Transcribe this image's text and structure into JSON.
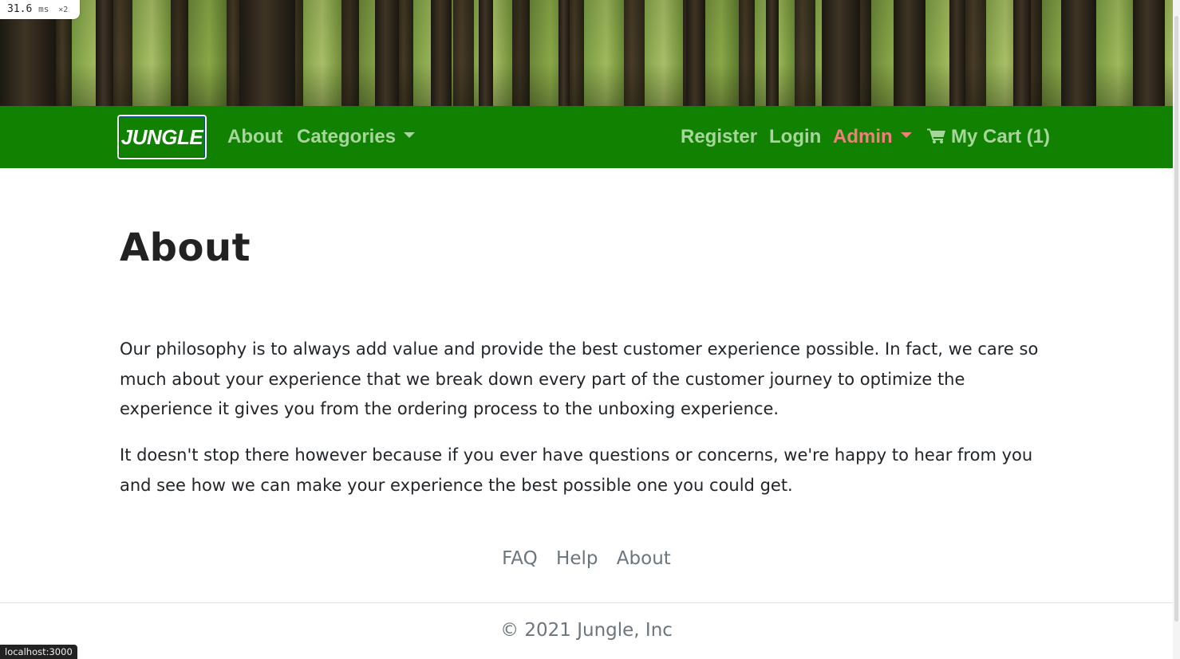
{
  "perf_overlay": {
    "value": "31.6",
    "unit": "ms",
    "multiplier": "×2"
  },
  "navbar": {
    "brand": "JUNGLE",
    "links": {
      "about": "About",
      "categories": "Categories",
      "register": "Register",
      "login": "Login",
      "admin": "Admin",
      "cart": "My Cart (1)"
    },
    "colors": {
      "background": "#118102",
      "link": "#a7d69c",
      "admin_link": "#f0807a"
    }
  },
  "main": {
    "title": "About",
    "paragraphs": [
      "Our philosophy is to always add value and provide the best customer experience possible. In fact, we care so much about your experience that we break down every part of the customer journey to optimize the experience it gives you from the ordering process to the unboxing experience.",
      "It doesn't stop there however because if you ever have questions or concerns, we're happy to hear from you and see how we can make your experience the best possible one you could get."
    ]
  },
  "footer": {
    "links": [
      "FAQ",
      "Help",
      "About"
    ],
    "copyright": "© 2021 Jungle, Inc"
  },
  "status_bar": {
    "url": "localhost:3000"
  },
  "icons": {
    "cart": "shopping-cart-icon",
    "dropdown": "caret-down-icon"
  }
}
